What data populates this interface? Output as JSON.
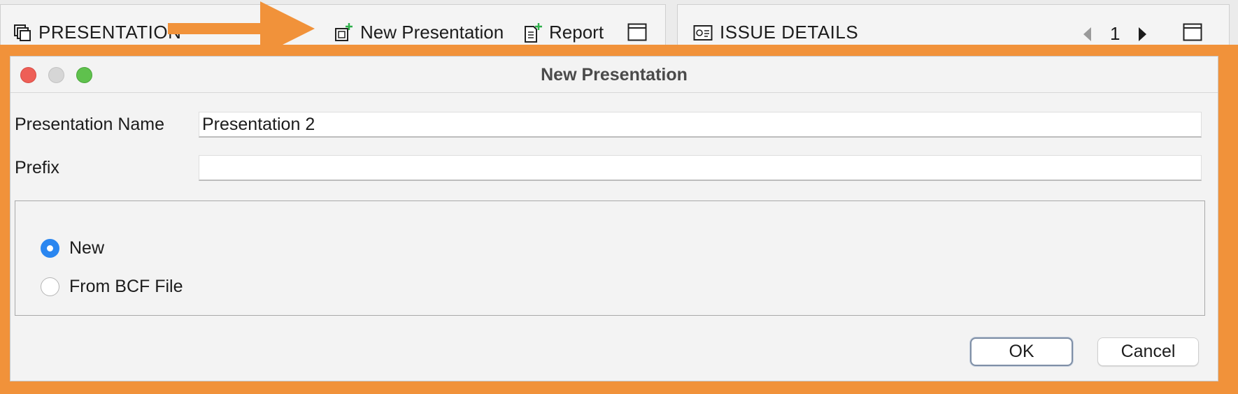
{
  "left_panel": {
    "title": "PRESENTATION",
    "new_presentation_label": "New Presentation",
    "report_label": "Report"
  },
  "right_panel": {
    "title": "ISSUE DETAILS",
    "page_number": "1"
  },
  "dialog": {
    "title": "New Presentation",
    "presentation_name_label": "Presentation Name",
    "presentation_name_value": "Presentation 2",
    "prefix_label": "Prefix",
    "prefix_value": "",
    "options": [
      {
        "label": "New",
        "selected": true
      },
      {
        "label": "From BCF File",
        "selected": false
      }
    ],
    "ok_label": "OK",
    "cancel_label": "Cancel"
  },
  "colors": {
    "highlight_orange": "#f1923a",
    "radio_selected": "#2a86f0",
    "add_badge_green": "#2eb04a",
    "window_close": "#ee5f57",
    "window_minimize": "#d6d6d6",
    "window_zoom": "#5fc14d"
  },
  "icons": {
    "presentation": "presentation-stack-icon",
    "new_presentation": "new-presentation-icon",
    "report": "new-report-icon",
    "window": "window-icon",
    "issue": "issue-details-icon",
    "previous": "triangle-left-icon",
    "next": "triangle-right-icon"
  }
}
